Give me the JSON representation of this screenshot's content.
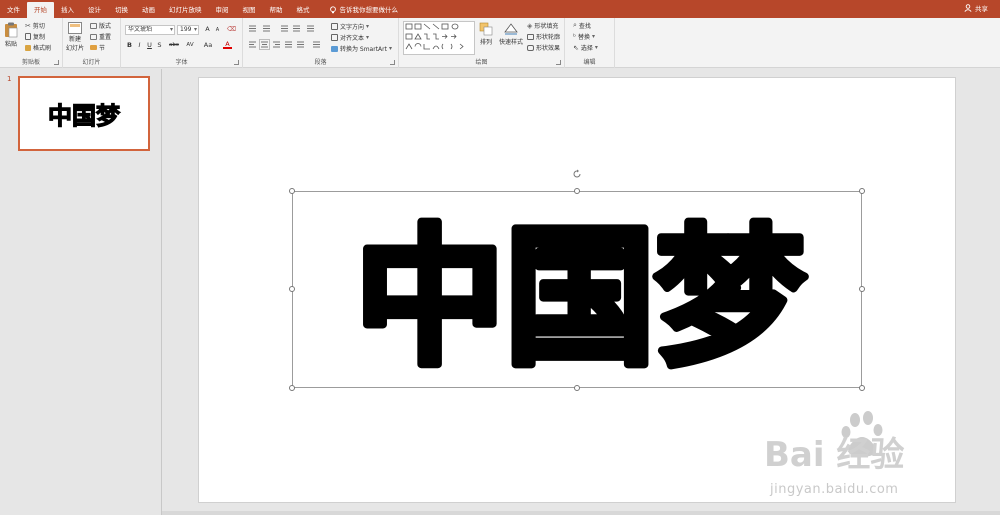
{
  "ribbon_tabs": [
    "文件",
    "开始",
    "插入",
    "设计",
    "切换",
    "动画",
    "幻灯片放映",
    "审阅",
    "视图",
    "帮助",
    "格式"
  ],
  "active_tab_index": 1,
  "tell_me": "告诉我你想要做什么",
  "share_label": "共享",
  "clipboard": {
    "label": "剪贴板",
    "paste": "粘贴",
    "cut": "剪切",
    "copy": "复制",
    "format_painter": "格式刷"
  },
  "slides_group": {
    "label": "幻灯片",
    "new_slide": "新建",
    "new_slide_line2": "幻灯片",
    "layout": "版式",
    "reset": "重置",
    "section": "节"
  },
  "font_group": {
    "label": "字体",
    "font_name": "华文琥珀",
    "font_size": "199",
    "bold": "B",
    "italic": "I",
    "underline": "U",
    "shadow": "S",
    "strikethrough": "abc",
    "spacing": "AV",
    "case": "Aa",
    "color": "A",
    "grow": "A",
    "shrink": "A"
  },
  "paragraph_group": {
    "label": "段落",
    "text_direction": "文字方向",
    "align_text": "对齐文本",
    "smartart": "转换为 SmartArt"
  },
  "drawing_group": {
    "label": "绘图",
    "arrange": "排列",
    "quick_styles": "快速样式",
    "shape_fill": "形状填充",
    "shape_outline": "形状轮廓",
    "shape_effects": "形状效果"
  },
  "editing_group": {
    "label": "编辑",
    "find": "查找",
    "replace": "替换",
    "select": "选择"
  },
  "slide_number": "1",
  "slide_text": "中国梦",
  "watermark": {
    "logo_text": "Bai  经验",
    "url": "jingyan.baidu.com"
  },
  "colors": {
    "accent": "#b7472a",
    "thumb_border": "#d2643c"
  }
}
